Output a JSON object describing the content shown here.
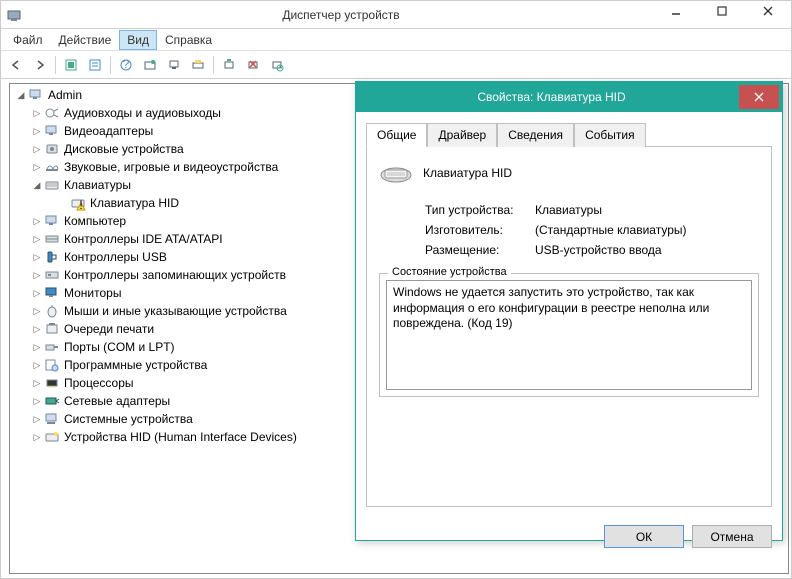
{
  "window": {
    "title": "Диспетчер устройств"
  },
  "menu": {
    "file": "Файл",
    "action": "Действие",
    "view": "Вид",
    "help": "Справка"
  },
  "tree": {
    "root": "Admin",
    "nodes": [
      "Аудиовходы и аудиовыходы",
      "Видеоадаптеры",
      "Дисковые устройства",
      "Звуковые, игровые и видеоустройства",
      "Клавиатуры",
      "Компьютер",
      "Контроллеры IDE ATA/ATAPI",
      "Контроллеры USB",
      "Контроллеры запоминающих устройств",
      "Мониторы",
      "Мыши и иные указывающие устройства",
      "Очереди печати",
      "Порты (COM и LPT)",
      "Программные устройства",
      "Процессоры",
      "Сетевые адаптеры",
      "Системные устройства",
      "Устройства HID (Human Interface Devices)"
    ],
    "keyboard_child": "Клавиатура HID"
  },
  "dialog": {
    "title": "Свойства: Клавиатура HID",
    "tabs": {
      "general": "Общие",
      "driver": "Драйвер",
      "details": "Сведения",
      "events": "События"
    },
    "device_name": "Клавиатура HID",
    "rows": {
      "type_label": "Тип устройства:",
      "type_value": "Клавиатуры",
      "mfg_label": "Изготовитель:",
      "mfg_value": "(Стандартные клавиатуры)",
      "loc_label": "Размещение:",
      "loc_value": "USB-устройство ввода"
    },
    "status_legend": "Состояние устройства",
    "status_text": "Windows не удается запустить это устройство, так как информация о его конфигурации в реестре неполна или повреждена. (Код 19)",
    "ok": "ОК",
    "cancel": "Отмена"
  }
}
